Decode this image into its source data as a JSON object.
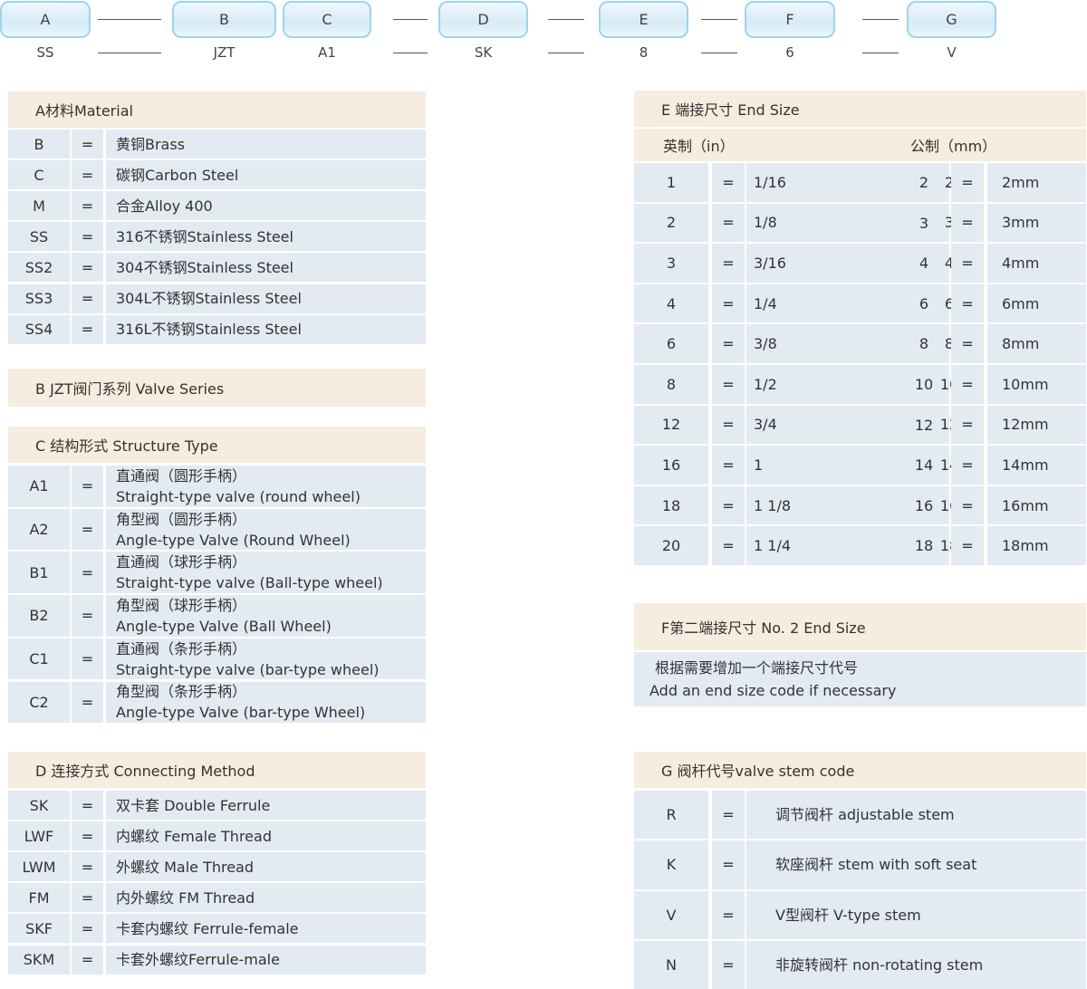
{
  "code": {
    "boxes": [
      "A",
      "B",
      "C",
      "D",
      "E",
      "F",
      "G"
    ],
    "values": [
      "SS",
      "JZT",
      "A1",
      "SK",
      "8",
      "6",
      "V"
    ]
  },
  "material": {
    "title": "A材料Material",
    "rows": [
      [
        "B",
        "=",
        "黄铜Brass"
      ],
      [
        "C",
        "=",
        "碳钢Carbon Steel"
      ],
      [
        "M",
        "=",
        "合金Alloy 400"
      ],
      [
        "SS",
        "=",
        "316不锈钢Stainless Steel"
      ],
      [
        "SS2",
        "=",
        "304不锈钢Stainless Steel"
      ],
      [
        "SS3",
        "=",
        "304L不锈钢Stainless Steel"
      ],
      [
        "SS4",
        "=",
        "316L不锈钢Stainless Steel"
      ]
    ]
  },
  "series": {
    "title": "B JZT阀门系列 Valve Series"
  },
  "structure": {
    "title": "C 结构形式 Structure Type",
    "rows": [
      [
        "A1",
        "=",
        "直通阀（圆形手柄）",
        "Straight-type valve (round wheel)"
      ],
      [
        "A2",
        "=",
        "角型阀（圆形手柄）",
        "Angle-type Valve (Round Wheel)"
      ],
      [
        "B1",
        "=",
        "直通阀（球形手柄）",
        "Straight-type valve (Ball-type wheel)"
      ],
      [
        "B2",
        "=",
        "角型阀（球形手柄）",
        "Angle-type Valve (Ball Wheel)"
      ],
      [
        "C1",
        "=",
        "直通阀（条形手柄）",
        "Straight-type valve (bar-type wheel)"
      ],
      [
        "C2",
        "=",
        "角型阀（条形手柄）",
        "Angle-type Valve (bar-type Wheel)"
      ]
    ]
  },
  "connecting": {
    "title": "D 连接方式 Connecting Method",
    "rows": [
      [
        "SK",
        "=",
        "双卡套 Double Ferrule"
      ],
      [
        "LWF",
        "=",
        "内螺纹 Female Thread"
      ],
      [
        "LWM",
        "=",
        "外螺纹 Male Thread"
      ],
      [
        "FM",
        "=",
        "内外螺纹 FM Thread"
      ],
      [
        "SKF",
        "=",
        "卡套内螺纹 Ferrule-female"
      ],
      [
        "SKM",
        "=",
        "卡套外螺纹Ferrule-male"
      ]
    ]
  },
  "endsize": {
    "title": "E 端接尺寸 End Size",
    "inch_label": "英制（in）",
    "mm_label": "公制（mm）",
    "rows": [
      [
        "1",
        "=",
        "1/16",
        "2",
        "=",
        "2mm"
      ],
      [
        "2",
        "=",
        "1/8",
        "3",
        "=",
        "3mm"
      ],
      [
        "3",
        "=",
        "3/16",
        "4",
        "=",
        "4mm"
      ],
      [
        "4",
        "=",
        "1/4",
        "6",
        "=",
        "6mm"
      ],
      [
        "6",
        "=",
        "3/8",
        "8",
        "=",
        "8mm"
      ],
      [
        "8",
        "=",
        "1/2",
        "10",
        "=",
        "10mm"
      ],
      [
        "12",
        "=",
        "3/4",
        "12",
        "=",
        "12mm"
      ],
      [
        "16",
        "=",
        "1",
        "14",
        "=",
        "14mm"
      ],
      [
        "18",
        "=",
        "1 1/8",
        "16",
        "=",
        "16mm"
      ],
      [
        "20",
        "=",
        "1 1/4",
        "18",
        "=",
        "18mm"
      ]
    ]
  },
  "second": {
    "title": "F第二端接尺寸 No. 2 End Size",
    "line1": "根据需要增加一个端接尺寸代号",
    "line2": "Add an end size code if necessary"
  },
  "stem": {
    "title": "G 阀杆代号valve stem code",
    "rows": [
      [
        "R",
        "=",
        "调节阀杆 adjustable stem"
      ],
      [
        "K",
        "=",
        "软座阀杆 stem with soft seat"
      ],
      [
        "V",
        "=",
        "V型阀杆 V-type stem"
      ],
      [
        "N",
        "=",
        "非旋转阀杆 non-rotating stem"
      ]
    ]
  },
  "colors": {
    "header": "#f6ecdf",
    "row": "#e3eaf2",
    "pill_border": "#9fd3ec"
  }
}
